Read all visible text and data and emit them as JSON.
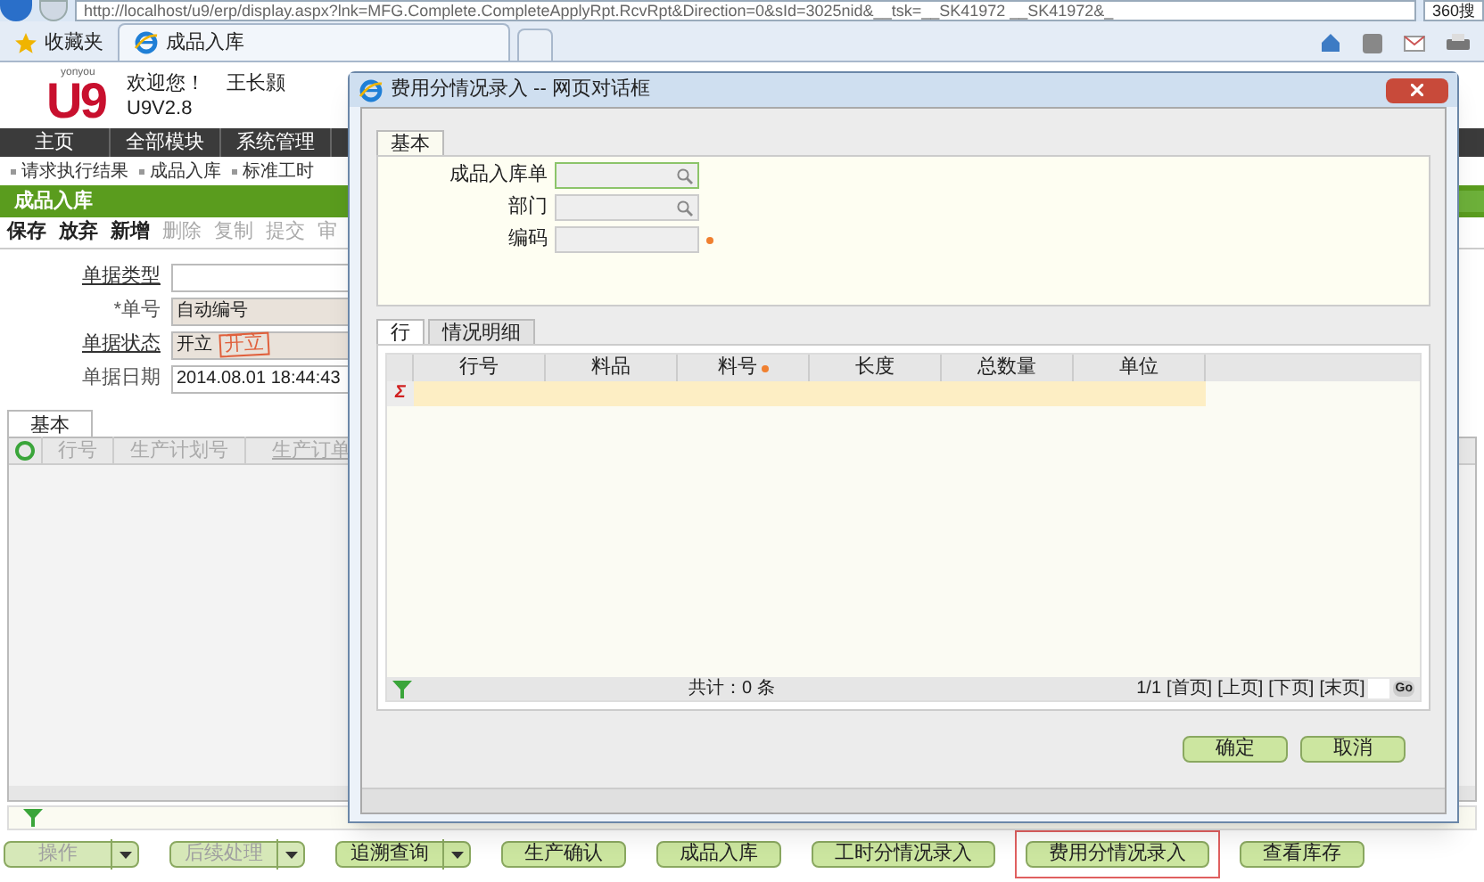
{
  "browser": {
    "url": "http://localhost/u9/erp/display.aspx?lnk=MFG.Complete.CompleteApplyRpt.RcvRpt&Direction=0&sId=3025nid&__tsk=__SK41972 __SK41972&_",
    "favorites": "收藏夹",
    "tab": "成品入库",
    "search_label": "360搜"
  },
  "header": {
    "logo_small": "yonyou",
    "logo": "U9",
    "welcome": "欢迎您！",
    "user": "王长颢",
    "version": "U9V2.8"
  },
  "nav": [
    "主页",
    "全部模块",
    "系统管理"
  ],
  "links": [
    "请求执行结果",
    "成品入库",
    "标准工时"
  ],
  "page_title": "成品入库",
  "toolbar": [
    {
      "label": "保存",
      "disabled": false
    },
    {
      "label": "放弃",
      "disabled": false
    },
    {
      "label": "新增",
      "disabled": false
    },
    {
      "label": "删除",
      "disabled": true
    },
    {
      "label": "复制",
      "disabled": true
    },
    {
      "label": "提交",
      "disabled": true
    },
    {
      "label": "审",
      "disabled": true
    }
  ],
  "form": [
    {
      "label": "单据类型",
      "link": true,
      "kind": "text"
    },
    {
      "label": "*单号",
      "link": false,
      "value": "自动编号",
      "kind": "readonly"
    },
    {
      "label": "单据状态",
      "link": true,
      "value": "开立",
      "stamp": "开立",
      "kind": "readonly"
    },
    {
      "label": "单据日期",
      "link": false,
      "value": "2014.08.01 18:44:43",
      "kind": "text"
    }
  ],
  "tabs": [
    {
      "label": "基本",
      "selected": true
    }
  ],
  "grid": {
    "columns": [
      "行号",
      "生产计划号",
      "生产订单"
    ]
  },
  "dialog": {
    "title": "费用分情况录入 -- 网页对话框",
    "header_tab": "基本",
    "fields": [
      {
        "label": "成品入库单",
        "kind": "lookup",
        "focused": true,
        "required": false
      },
      {
        "label": "部门",
        "kind": "lookup",
        "focused": false,
        "required": false
      },
      {
        "label": "编码",
        "kind": "text",
        "focused": false,
        "required": true
      }
    ],
    "tabs": [
      {
        "label": "行",
        "selected": true
      },
      {
        "label": "情况明细",
        "selected": false
      }
    ],
    "columns": [
      {
        "label": "行号",
        "required": false
      },
      {
        "label": "料品",
        "required": false
      },
      {
        "label": "料号",
        "required": true
      },
      {
        "label": "长度",
        "required": false
      },
      {
        "label": "总数量",
        "required": false
      },
      {
        "label": "单位",
        "required": false
      }
    ],
    "sum_mark": "Σ",
    "total": "共计：0 条",
    "pager": {
      "position": "1/1",
      "links": [
        "[首页]",
        "[上页]",
        "[下页]",
        "[末页]"
      ],
      "go": "Go"
    },
    "buttons": [
      "确定",
      "取消"
    ]
  },
  "actions": [
    {
      "label": "操作",
      "kind": "split",
      "disabled": true,
      "highlighted": false
    },
    {
      "label": "后续处理",
      "kind": "split",
      "disabled": true,
      "highlighted": false
    },
    {
      "label": "追溯查询",
      "kind": "split",
      "disabled": false,
      "highlighted": false
    },
    {
      "label": "生产确认",
      "kind": "plain",
      "disabled": false,
      "highlighted": false
    },
    {
      "label": "成品入库",
      "kind": "plain",
      "disabled": false,
      "highlighted": false
    },
    {
      "label": "工时分情况录入",
      "kind": "plain",
      "disabled": false,
      "highlighted": false
    },
    {
      "label": "费用分情况录入",
      "kind": "plain",
      "disabled": false,
      "highlighted": true
    },
    {
      "label": "查看库存",
      "kind": "plain",
      "disabled": false,
      "highlighted": false
    }
  ]
}
